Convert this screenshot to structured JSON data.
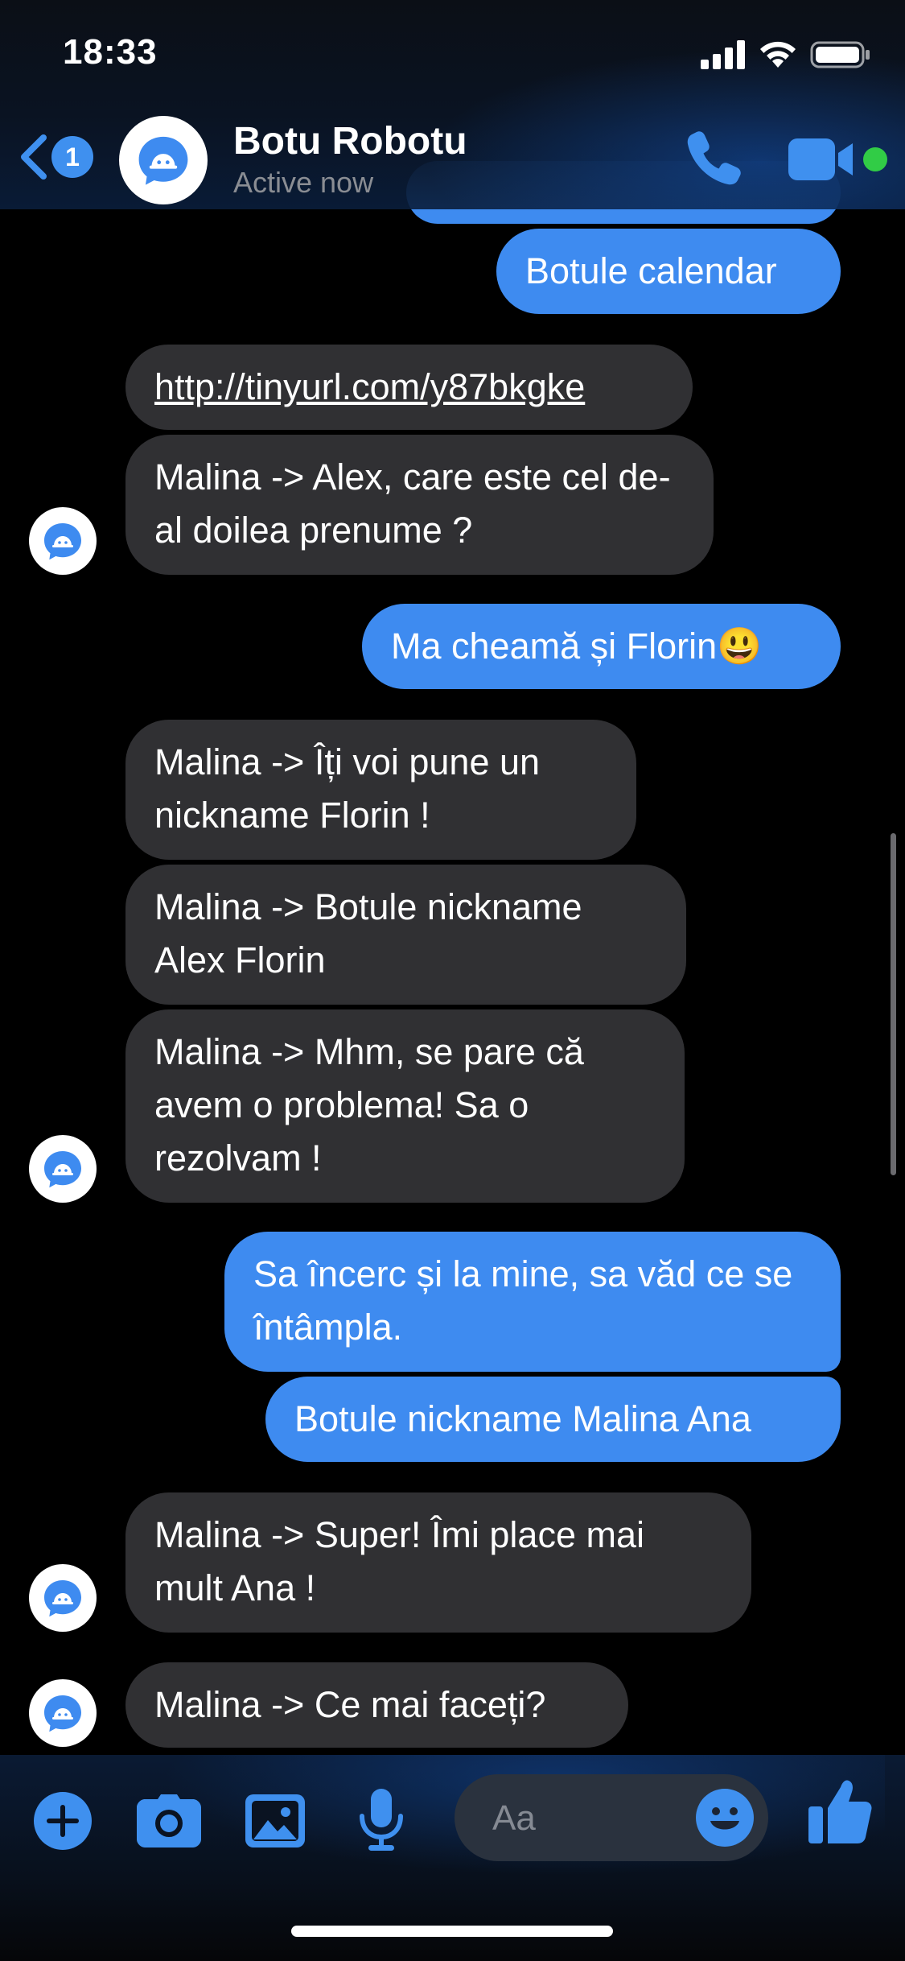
{
  "status_bar": {
    "time": "18:33"
  },
  "header": {
    "back_badge_count": "1",
    "contact_name": "Botu Robotu",
    "contact_status": "Active now",
    "icons": [
      "back-chevron-icon",
      "bot-avatar-icon",
      "phone-icon",
      "video-camera-icon",
      "online-dot"
    ]
  },
  "messages": [
    {
      "side": "out",
      "text": "Botule calendar"
    },
    {
      "side": "in",
      "text": "http://tinyurl.com/y87bkgke",
      "is_link": true
    },
    {
      "side": "in",
      "text": "Malina -> Alex, care este cel de-al doilea prenume ?"
    },
    {
      "side": "out",
      "text": "Ma cheamă și Florin",
      "emoji": "😃"
    },
    {
      "side": "in",
      "text": "Malina -> Îți voi pune un nickname Florin !"
    },
    {
      "side": "in",
      "text": "Malina -> Botule nickname Alex Florin"
    },
    {
      "side": "in",
      "text": "Malina -> Mhm, se pare că avem o problema! Sa o rezolvam !"
    },
    {
      "side": "out",
      "text": "Sa încerc și la mine, sa văd ce se întâmpla."
    },
    {
      "side": "out",
      "text": "Botule nickname Malina Ana"
    },
    {
      "side": "in",
      "text": "Malina -> Super! Îmi place mai mult Ana !"
    },
    {
      "side": "in",
      "text": "Malina -> Ce mai faceți?"
    }
  ],
  "composer": {
    "placeholder": "Aa",
    "tools": [
      "plus-icon",
      "camera-icon",
      "gallery-icon",
      "microphone-icon",
      "emoji-icon",
      "thumbs-up-icon"
    ]
  },
  "colors": {
    "accent": "#3e8bf0",
    "incoming_bubble": "#303033",
    "online": "#31cc46"
  }
}
